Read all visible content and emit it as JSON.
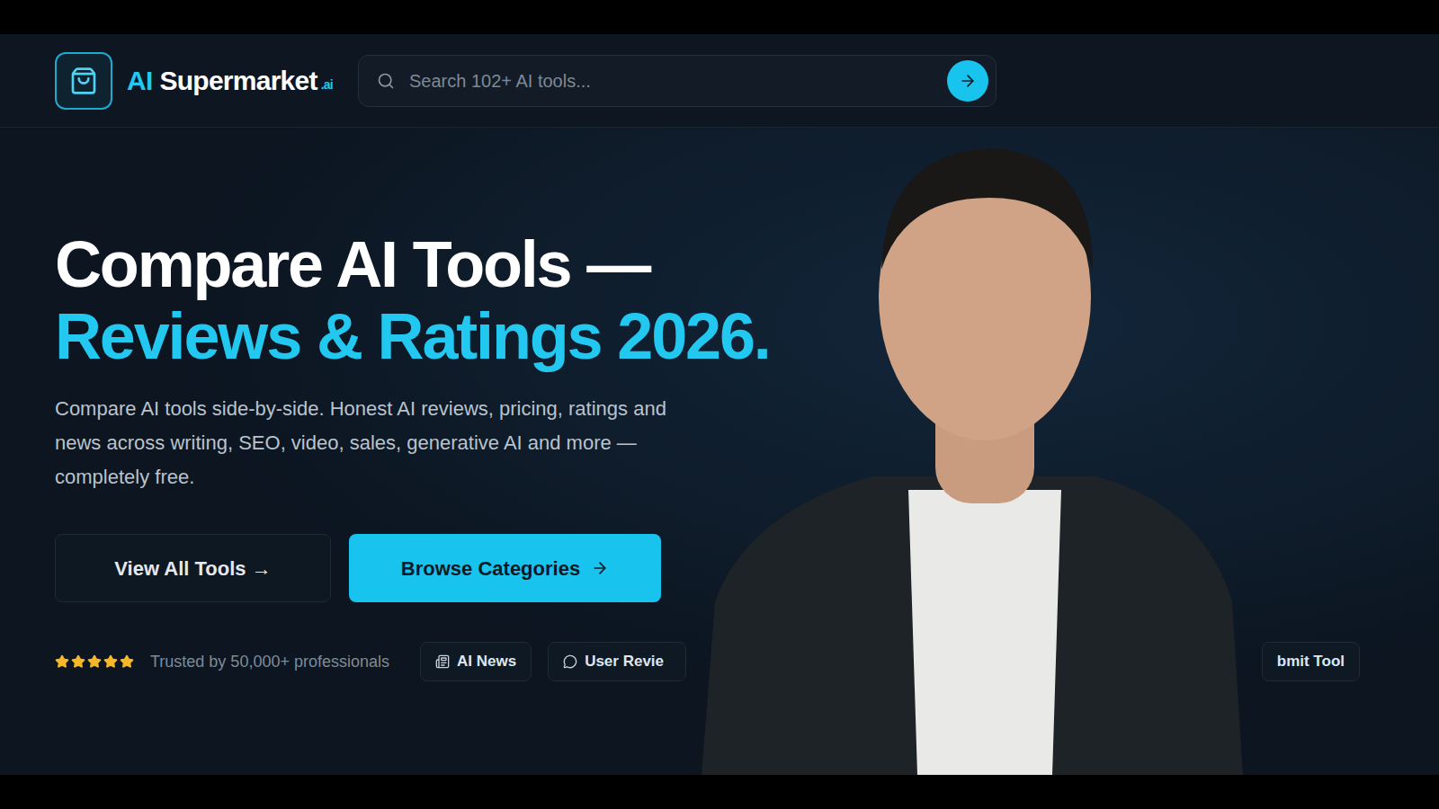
{
  "logo": {
    "prefix": "AI",
    "name": "Supermarket",
    "badge": ".ai"
  },
  "search": {
    "placeholder": "Search 102+ AI tools..."
  },
  "hero": {
    "title": "Compare AI Tools —",
    "subtitle": "Reviews & Ratings 2026.",
    "description": "Compare AI tools side-by-side. Honest AI reviews, pricing, ratings and news across writing, SEO, video, sales, generative AI and more — completely free."
  },
  "buttons": [
    {
      "label": "View All Tools →",
      "kind": "secondary"
    },
    {
      "label": "Browse Categories",
      "kind": "primary"
    }
  ],
  "trust": {
    "stars": 5,
    "text": "Trusted by 50,000+ professionals"
  },
  "links": [
    {
      "label": "AI News",
      "kind": "news"
    },
    {
      "label": "User Revie",
      "kind": "reviews"
    },
    {
      "label": "bmit Tool",
      "kind": "submit"
    }
  ]
}
